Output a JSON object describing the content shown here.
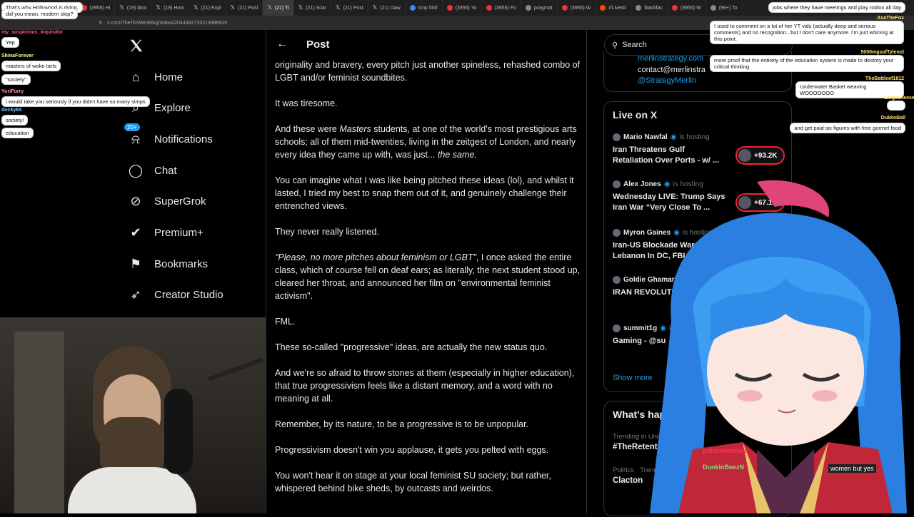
{
  "browser": {
    "tabs": [
      {
        "label": "(3956) W",
        "icon": "youtube-icon"
      },
      {
        "label": "(3956) W",
        "icon": "youtube-icon"
      },
      {
        "label": "(3956) Hi",
        "icon": "youtube-icon"
      },
      {
        "label": "(19) bloo",
        "icon": "x-icon"
      },
      {
        "label": "(19) Hom",
        "icon": "x-icon"
      },
      {
        "label": "(21) Expl",
        "icon": "x-icon"
      },
      {
        "label": "(21) Post",
        "icon": "x-icon"
      },
      {
        "label": "(21) Ti",
        "icon": "x-icon",
        "active": true
      },
      {
        "label": "(21) Scar",
        "icon": "x-icon"
      },
      {
        "label": "(21) Post",
        "icon": "x-icon"
      },
      {
        "label": "(21) claw",
        "icon": "x-icon"
      },
      {
        "label": "smp 500",
        "icon": "google-icon"
      },
      {
        "label": "(3956) Yo",
        "icon": "youtube-icon"
      },
      {
        "label": "(3956) Fo",
        "icon": "youtube-icon"
      },
      {
        "label": "pragmat",
        "icon": "site-icon"
      },
      {
        "label": "(3956) W",
        "icon": "youtube-icon"
      },
      {
        "label": "r/Livestr",
        "icon": "reddit-icon"
      },
      {
        "label": "blackfac",
        "icon": "site-icon"
      },
      {
        "label": "(3956) W",
        "icon": "youtube-icon"
      },
      {
        "label": "(99+) To",
        "icon": "site-icon"
      }
    ],
    "url": "x.com/TheTimMenBlog/status/2044492733213986916"
  },
  "nav": {
    "items": [
      {
        "label": "Home",
        "icon": "home-icon"
      },
      {
        "label": "Explore",
        "icon": "search-icon"
      },
      {
        "label": "Notifications",
        "icon": "bell-icon",
        "badge": "20+"
      },
      {
        "label": "Chat",
        "icon": "chat-icon"
      },
      {
        "label": "SuperGrok",
        "icon": "grok-icon"
      },
      {
        "label": "Premium+",
        "icon": "verified-icon"
      },
      {
        "label": "Bookmarks",
        "icon": "bookmark-icon"
      },
      {
        "label": "Creator Studio",
        "icon": "rocket-icon"
      }
    ]
  },
  "post": {
    "header": "Post",
    "paragraphs": [
      "originality and bravery, every pitch just another spineless, rehashed combo of LGBT and/or feminist soundbites.",
      "It was tiresome.",
      "And these were Masters students, at one of the world's most prestigious arts schools; all of them mid-twenties, living in the zeitgest of London, and nearly every idea they came up with, was just... the same.",
      "You can imagine what I was like being pitched these ideas (lol), and whilst it lasted, I tried my best to snap them out of it, and genuinely challenge their entrenched views.",
      "They never really listened.",
      "\"Please, no more pitches about feminism or LGBT\", I once asked the entire class, which of course fell on deaf ears; as literally, the next student stood up, cleared her throat, and announced her film on \"environmental feminist activism\".",
      "FML.",
      "These so-called \"progressive\" ideas, are actually the new status quo.",
      "And we're so afraid to throw stones at them (especially in higher education), that true progressivism feels like a distant memory, and a word with no meaning at all.",
      "Remember, by its nature, to be a progressive is to be unpopular.",
      "Progressivism doesn't win you applause, it gets you pelted with eggs.",
      "You won't hear it on stage at your local feminist SU society; but rather, whispered behind bike sheds, by outcasts and weirdos."
    ]
  },
  "right": {
    "search_placeholder": "Search",
    "contact": {
      "line1": "merlinstrategy.com",
      "line2": "contact@merlinstra",
      "handle": "@StrategyMerlin"
    },
    "live_title": "Live on X",
    "hosting_label": "is hosting",
    "live": [
      {
        "host": "Mario Nawfal",
        "title": "Iran Threatens Gulf Retaliation Over Ports - w/ ...",
        "count": "+93.2K"
      },
      {
        "host": "Alex Jones",
        "title": "Wednesday LIVE: Trump Says Iran War “Very Close To ...",
        "count": "+67.1K"
      },
      {
        "host": "Myron Gaines",
        "title": "Iran-US Blockade War, Isr And Lebanon In DC, FBI",
        "count": ""
      },
      {
        "host": "Goldie Ghamari",
        "title": "IRAN REVOLUTION 109",
        "count": ""
      },
      {
        "host": "summit1g",
        "title": "Gaming - @su",
        "count": ""
      }
    ],
    "show_more": "Show more",
    "happening_title": "What's happen",
    "trends": [
      {
        "context": "Trending in United States",
        "name": "#TheRetention"
      },
      {
        "context": "Politics · Trending",
        "name": "Clacton"
      }
    ]
  },
  "chat_left": [
    {
      "user": "",
      "text": "That's why Hollywood is dying.",
      "color": "#f7c"
    },
    {
      "user": "",
      "text": "did you mean, modern slop?",
      "color": "#f55"
    },
    {
      "user": "my_suspicious_inquisitor",
      "text": "Yep",
      "color": "#f5a"
    },
    {
      "user": "ShinaForever",
      "text": "masters of woke tarts",
      "color": "#ff8"
    },
    {
      "user": "",
      "text": "\"society\"",
      "color": "#8f8"
    },
    {
      "user": "YuriFurry",
      "text": "i would take you seriously if you didn't have so many simps",
      "color": "#f9c"
    },
    {
      "user": "docky64",
      "text": "society!",
      "color": "#8cf"
    },
    {
      "user": "",
      "text": "education",
      "color": "#fc8"
    }
  ],
  "chat_right": [
    {
      "user": "",
      "text": "jobs where they have meetings and play roblox all day"
    },
    {
      "user": "AsaTheFox",
      "text": "I used to comment on a lot of her YT vids (actually deep and serious comments) and no recognition...but I don't care anymore. I'm just whining at this point."
    },
    {
      "user": "5000mgsofTylenol",
      "text": "more proof that the entirety of the education system is made to destroy your critical thinking"
    },
    {
      "user": "TheBattleof1812",
      "text": "Underwater Basket weaving WOOOOOOO"
    },
    {
      "user": "Largecheeseslop",
      "text": ""
    },
    {
      "user": "DukkoBall",
      "text": "and get paid six figures with free gormet food"
    }
  ],
  "overlay_chat": [
    {
      "user": "pokemonnikes",
      "text": ""
    },
    {
      "user": "DunkinBeezN",
      "text": "women but yes"
    }
  ],
  "colors": {
    "accent": "#1d9bf0",
    "background": "#000000",
    "border": "#2f3336",
    "live_ring": "#f4212e"
  }
}
